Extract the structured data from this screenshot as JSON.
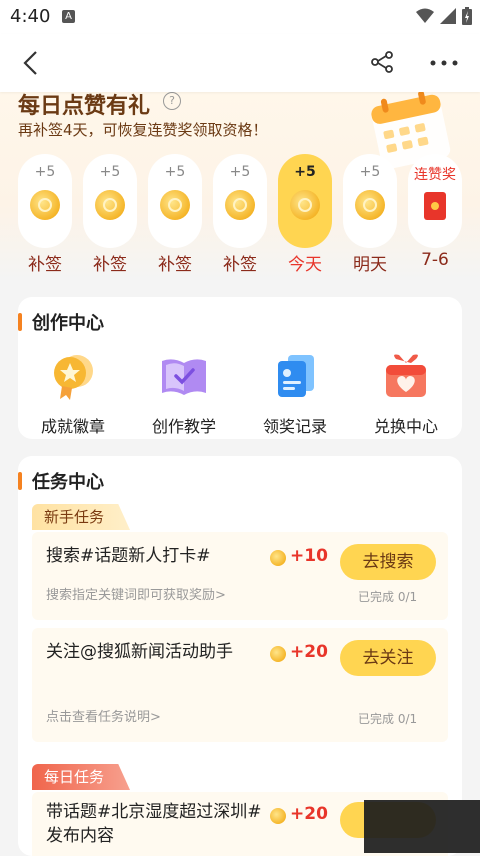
{
  "status_bar": {
    "time": "4:40",
    "notification_icon": "A"
  },
  "nav": {
    "icons": [
      "back-arrow-icon",
      "share-icon",
      "more-icon"
    ]
  },
  "signin": {
    "title": "每日点赞有礼",
    "subtitle": "再补签4天，可恢复连赞奖领取资格！",
    "days": [
      {
        "points": "+5",
        "label": "补签",
        "state": "makeup"
      },
      {
        "points": "+5",
        "label": "补签",
        "state": "makeup"
      },
      {
        "points": "+5",
        "label": "补签",
        "state": "makeup"
      },
      {
        "points": "+5",
        "label": "补签",
        "state": "makeup"
      },
      {
        "points": "+5",
        "label": "今天",
        "state": "today"
      },
      {
        "points": "+5",
        "label": "明天",
        "state": "future"
      },
      {
        "points": "连赞奖",
        "label": "7-6",
        "state": "bonus"
      }
    ]
  },
  "creation_center": {
    "title": "创作中心",
    "tools": [
      {
        "label": "成就徽章",
        "icon": "medal-icon"
      },
      {
        "label": "创作教学",
        "icon": "book-icon"
      },
      {
        "label": "领奖记录",
        "icon": "record-icon"
      },
      {
        "label": "兑换中心",
        "icon": "gift-icon"
      }
    ]
  },
  "task_center": {
    "title": "任务中心",
    "newbie_tag": "新手任务",
    "daily_tag": "每日任务",
    "tasks": [
      {
        "title": "搜索#话题新人打卡#",
        "reward": "+10",
        "button": "去搜索",
        "desc": "搜索指定关键词即可获取奖励>",
        "progress": "已完成 0/1"
      },
      {
        "title": "关注@搜狐新闻活动助手",
        "reward": "+20",
        "button": "去关注",
        "desc": "点击查看任务说明>",
        "progress": "已完成 0/1"
      },
      {
        "title": "带话题#北京湿度超过深圳#发布内容",
        "reward": "+20",
        "button": ""
      }
    ]
  },
  "colors": {
    "accent": "#ffd551",
    "brand_red": "#e8352a",
    "title_brown": "#6b3a14",
    "section_bar": "#f58220"
  }
}
